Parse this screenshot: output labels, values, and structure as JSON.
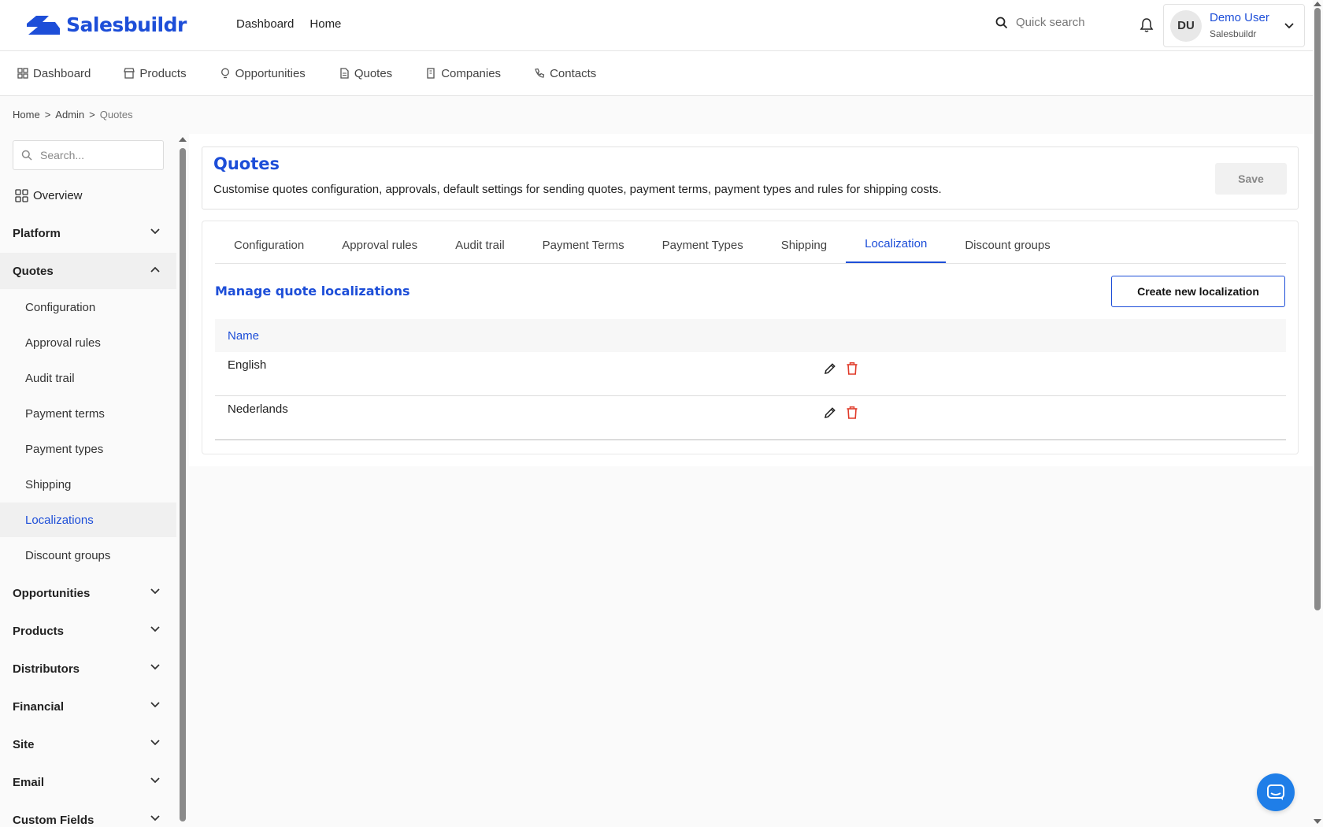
{
  "app": {
    "brand": "Salesbuildr",
    "accent_color": "#1d4ed8",
    "top_nav": [
      "Dashboard",
      "Home"
    ],
    "quick_search_placeholder": "Quick search"
  },
  "user": {
    "initials": "DU",
    "name": "Demo User",
    "org": "Salesbuildr"
  },
  "subnav": [
    {
      "label": "Dashboard",
      "icon": "dashboard-icon"
    },
    {
      "label": "Products",
      "icon": "store-icon"
    },
    {
      "label": "Opportunities",
      "icon": "lightbulb-icon"
    },
    {
      "label": "Quotes",
      "icon": "document-icon"
    },
    {
      "label": "Companies",
      "icon": "building-icon"
    },
    {
      "label": "Contacts",
      "icon": "phone-icon"
    }
  ],
  "breadcrumb": [
    "Home",
    "Admin",
    "Quotes"
  ],
  "sidebar": {
    "search_placeholder": "Search...",
    "overview": "Overview",
    "groups_top": [
      "Platform",
      "Quotes"
    ],
    "quotes_items": [
      "Configuration",
      "Approval rules",
      "Audit trail",
      "Payment terms",
      "Payment types",
      "Shipping",
      "Localizations",
      "Discount groups"
    ],
    "active_item": "Localizations",
    "groups_bottom": [
      "Opportunities",
      "Products",
      "Distributors",
      "Financial",
      "Site",
      "Email",
      "Custom Fields"
    ]
  },
  "page": {
    "title": "Quotes",
    "description": "Customise quotes configuration, approvals, default settings for sending quotes, payment terms, payment types and rules for shipping costs.",
    "save_label": "Save"
  },
  "tabs": [
    "Configuration",
    "Approval rules",
    "Audit trail",
    "Payment Terms",
    "Payment Types",
    "Shipping",
    "Localization",
    "Discount groups"
  ],
  "active_tab": "Localization",
  "section": {
    "title": "Manage quote localizations",
    "create_label": "Create new localization"
  },
  "table": {
    "header": "Name",
    "rows": [
      "English",
      "Nederlands"
    ]
  }
}
